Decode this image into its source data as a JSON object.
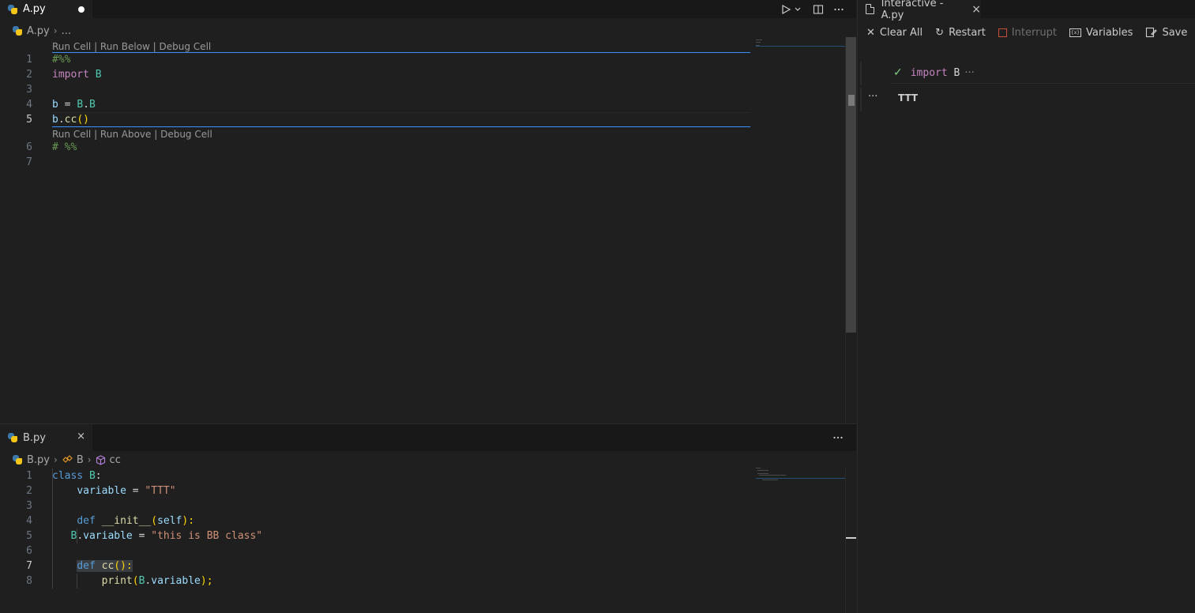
{
  "top_editor": {
    "tab": {
      "label": "A.py",
      "icon": "python-icon",
      "dirty": true
    },
    "actions": {
      "run_icon": "play-icon",
      "run_menu_icon": "chevron-down-icon",
      "split_icon": "split-editor-icon",
      "more_icon": "ellipsis-icon"
    },
    "breadcrumb": {
      "file": "A.py",
      "rest": "..."
    },
    "codelens_top": "Run Cell | Run Below | Debug Cell",
    "codelens_bottom": "Run Cell | Run Above | Debug Cell",
    "line_numbers": [
      "1",
      "2",
      "3",
      "4",
      "5",
      "6",
      "7"
    ],
    "lines": {
      "l1": "#%%",
      "l2_kw": "import",
      "l2_mod": "B",
      "l4_var": "b",
      "l4_eq": " = ",
      "l4_mod": "B",
      "l4_dot": ".",
      "l4_cls": "B",
      "l5_var": "b",
      "l5_dot": ".",
      "l5_fn": "cc",
      "l5_parens": "()",
      "l6": "# %%"
    }
  },
  "bottom_editor": {
    "tab": {
      "label": "B.py",
      "icon": "python-icon",
      "close": "×"
    },
    "actions": {
      "more_icon": "ellipsis-icon"
    },
    "breadcrumb": {
      "file": "B.py",
      "class": "B",
      "method": "cc"
    },
    "line_numbers": [
      "1",
      "2",
      "3",
      "4",
      "5",
      "6",
      "7",
      "8"
    ],
    "lines": {
      "l1_kw": "class",
      "l1_name": "B",
      "l1_colon": ":",
      "l2_var": "variable",
      "l2_eq": " = ",
      "l2_str": "\"TTT\"",
      "l4_kw": "def",
      "l4_fn": "__init__",
      "l4_open": "(",
      "l4_self": "self",
      "l4_close": "):",
      "l5_cls": "B",
      "l5_dot": ".",
      "l5_var": "variable",
      "l5_eq": " = ",
      "l5_str": "\"this is BB class\"",
      "l7_kw": "def",
      "l7_fn": "cc",
      "l7_parens": "():",
      "l8_fn": "print",
      "l8_open": "(",
      "l8_cls": "B",
      "l8_dot": ".",
      "l8_var": "variable",
      "l8_close": ");"
    }
  },
  "interactive": {
    "tab": {
      "label": "Interactive - A.py",
      "icon": "file-icon",
      "close": "×"
    },
    "toolbar": {
      "clear_all": "Clear All",
      "restart": "Restart",
      "interrupt": "Interrupt",
      "variables": "Variables",
      "save": "Save"
    },
    "cell": {
      "keyword": "import",
      "module": "B",
      "more": "···",
      "status_icon": "check-icon"
    },
    "output": {
      "menu": "···",
      "text": "TTT"
    }
  },
  "colors": {
    "accent": "#3794ff",
    "success": "#89d185",
    "error": "#c74e39",
    "background": "#1f1f1f"
  }
}
